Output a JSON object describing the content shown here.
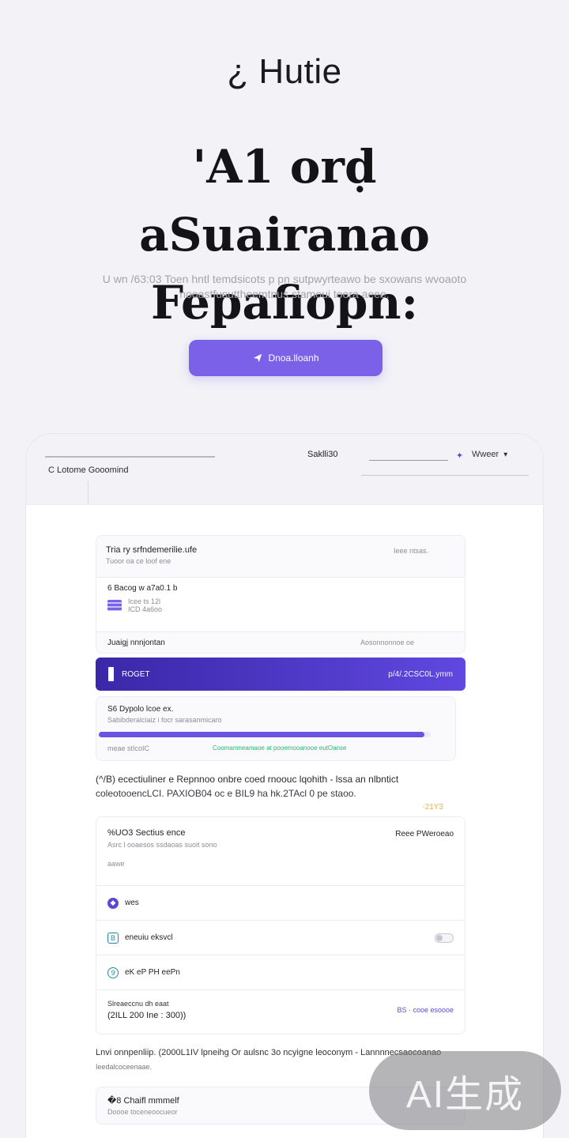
{
  "hero": {
    "brand": "¿ Hutie",
    "headline_line1": "'A1 orḍ aSuairanao",
    "headline_line2": "Fepafiopn:",
    "subtext_line1": "U wn /63:03 Toen hntl temdsicots p pn sutpwyrteawo be sxowans wvoaoto",
    "subtext_line2": "nooastfusuttheemtnus stamoui toora aeee.",
    "cta_label": "Dnoa.lloanh"
  },
  "app": {
    "window_title": "C Lotome  Gooomind",
    "search_label": "Saklli30",
    "user_label": "Wweer"
  },
  "card1": {
    "title": "Tria ry srfndemerilie.ufe",
    "meta": "Ieee ntsas.",
    "subtitle": "Tuoor oa ce loof ene",
    "item_label": "6 Bacog  w a7a0.1 b",
    "item_sub1": "Icee ts 12l",
    "item_sub2": "ICD  4a6oo",
    "row_label": "Juaigj nnnjontan",
    "row_meta": "Aosonnonnoe oe"
  },
  "purple_bar": {
    "label": "ROGET",
    "value": "p/4/.2CSC0L.ymm"
  },
  "card2": {
    "title": "S6 Dypolo lcoe ex.",
    "subtitle": "Sabibderalciaiz i focr  sarasanmicaro",
    "progress": 0.98,
    "foot_left": "meae stIcoIC",
    "foot_right": "Coomamneamaoe at pooemooanooe eutOanse"
  },
  "note1": {
    "line1": "(^/B) ecectiuliner e Repnnoo onbre coed rnoouc  lqohith    -  lssa an nlbntict",
    "line2": "coleotooencLCI. PAXIOB04   oc e BIL9 ha hk.2TAcl 0 pe staoo.",
    "tag": "-21Y3"
  },
  "card3": {
    "title": "%UO3 Sectius ence",
    "subtitle": "Asrc l ooaesos ssdaoas suoit sono",
    "meta": "Reee PWeroeao",
    "sub2": "aawe",
    "items": [
      {
        "label": "wes"
      },
      {
        "label": "eneuiu eksvcl"
      },
      {
        "label": "eK  eP   PH  eePn"
      }
    ],
    "foot_label": "Slreaeccnu dh eaat",
    "foot_value": "(2ILL 200 Ine : 300))",
    "foot_meta": "BS  ·  cooe esoooe"
  },
  "note2": {
    "line1": "Lnvi onnpenliip.  (2000L1IV  lpneihg Or aulsnc 3o ncyigne leoconym  -  Lannnnecsaocoanao",
    "line2": "Ieedalcoceenaae."
  },
  "card4": {
    "title": "�8 Chaifl mmmelf",
    "subtitle": "Doooe toceneoocueor"
  },
  "watermark": "AI生成",
  "colors": {
    "accent": "#7b61e8",
    "accent_dark": "#3a27a8",
    "background": "#f2f2f7",
    "success_text": "#2bb673"
  }
}
